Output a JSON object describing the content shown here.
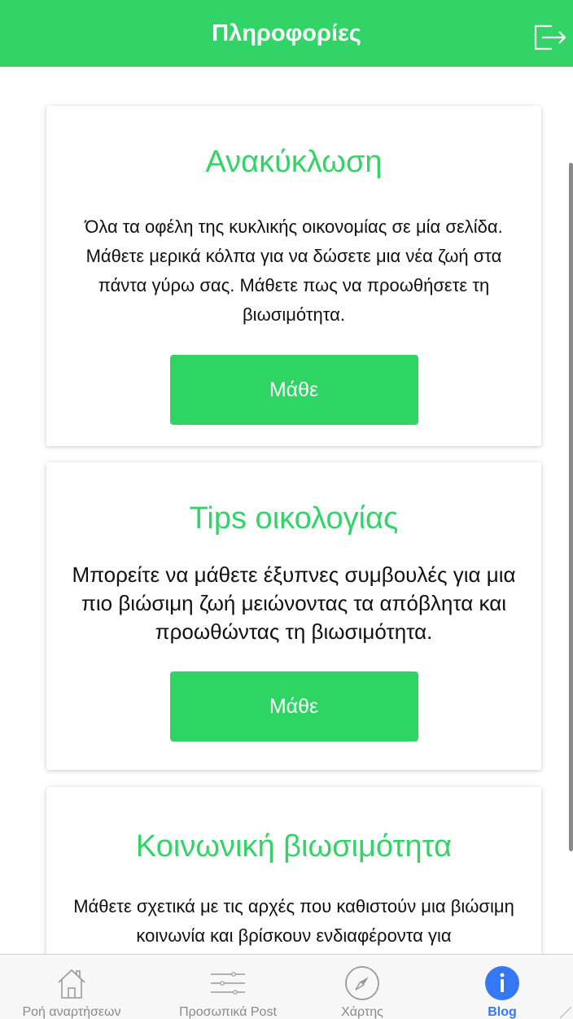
{
  "header": {
    "title": "Πληροφορίες",
    "logout_icon": "logout-icon"
  },
  "cards": [
    {
      "title": "Ανακύκλωση",
      "text": "Όλα τα οφέλη της κυκλικής οικονομίας σε μία σελίδα. Μάθετε μερικά κόλπα για να δώσετε μια νέα ζωή στα πάντα γύρω σας. Μάθετε πως να προωθήσετε τη βιωσιμότητα.",
      "button": "Μάθε"
    },
    {
      "title": "Tips οικολογίας",
      "text": "Μπορείτε να μάθετε έξυπνες συμβουλές για μια πιο βιώσιμη ζωή μειώνοντας τα απόβλητα και προωθώντας τη βιωσιμότητα.",
      "button": "Μάθε"
    },
    {
      "title": "Κοινωνική βιωσιμότητα",
      "text": "Μάθετε σχετικά με τις αρχές που καθιστούν μια βιώσιμη κοινωνία και βρίσκουν ενδιαφέροντα για"
    }
  ],
  "tabs": [
    {
      "label": "Ροή αναρτήσεων",
      "icon": "home-icon",
      "active": false
    },
    {
      "label": "Προσωπικά Post",
      "icon": "sliders-icon",
      "active": false
    },
    {
      "label": "Χάρτης",
      "icon": "compass-icon",
      "active": false
    },
    {
      "label": "Blog",
      "icon": "info-icon",
      "active": true
    }
  ],
  "colors": {
    "accent": "#33d467",
    "active_tab": "#3478f6",
    "inactive_tab": "#8a8a8a"
  }
}
